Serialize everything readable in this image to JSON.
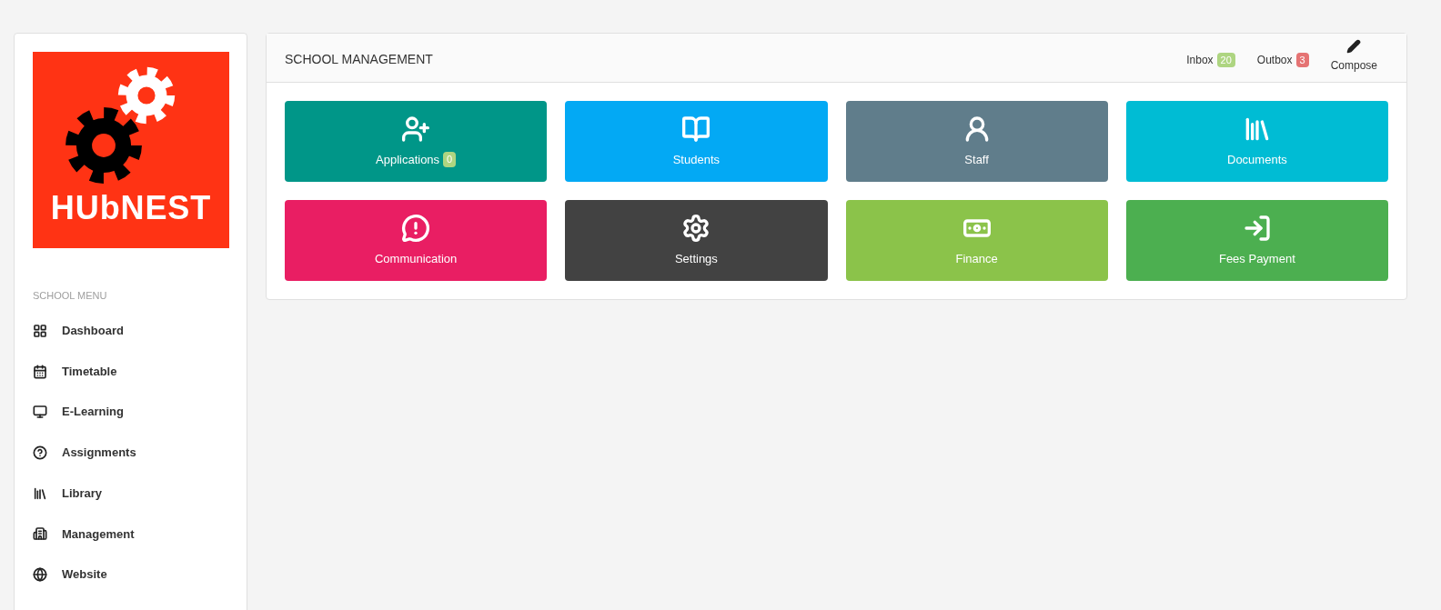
{
  "logo": {
    "text": "HUbNEST"
  },
  "sidebar": {
    "heading": "SCHOOL MENU",
    "items": [
      {
        "label": "Dashboard"
      },
      {
        "label": "Timetable"
      },
      {
        "label": "E-Learning"
      },
      {
        "label": "Assignments"
      },
      {
        "label": "Library"
      },
      {
        "label": "Management"
      },
      {
        "label": "Website"
      }
    ]
  },
  "panel": {
    "title": "SCHOOL MANAGEMENT",
    "mail": [
      {
        "label": "Inbox",
        "count": "20",
        "color": "#aed581"
      },
      {
        "label": "Outbox",
        "count": "3",
        "color": "#e57373"
      }
    ],
    "compose": "Compose"
  },
  "tiles": [
    {
      "label": "Applications",
      "badge": "0",
      "color": "#009688"
    },
    {
      "label": "Students",
      "color": "#03a9f4"
    },
    {
      "label": "Staff",
      "color": "#607d8b"
    },
    {
      "label": "Documents",
      "color": "#00bcd4"
    },
    {
      "label": "Communication",
      "color": "#e91e63"
    },
    {
      "label": "Settings",
      "color": "#424242"
    },
    {
      "label": "Finance",
      "color": "#8bc34a"
    },
    {
      "label": "Fees Payment",
      "color": "#4caf50"
    }
  ]
}
